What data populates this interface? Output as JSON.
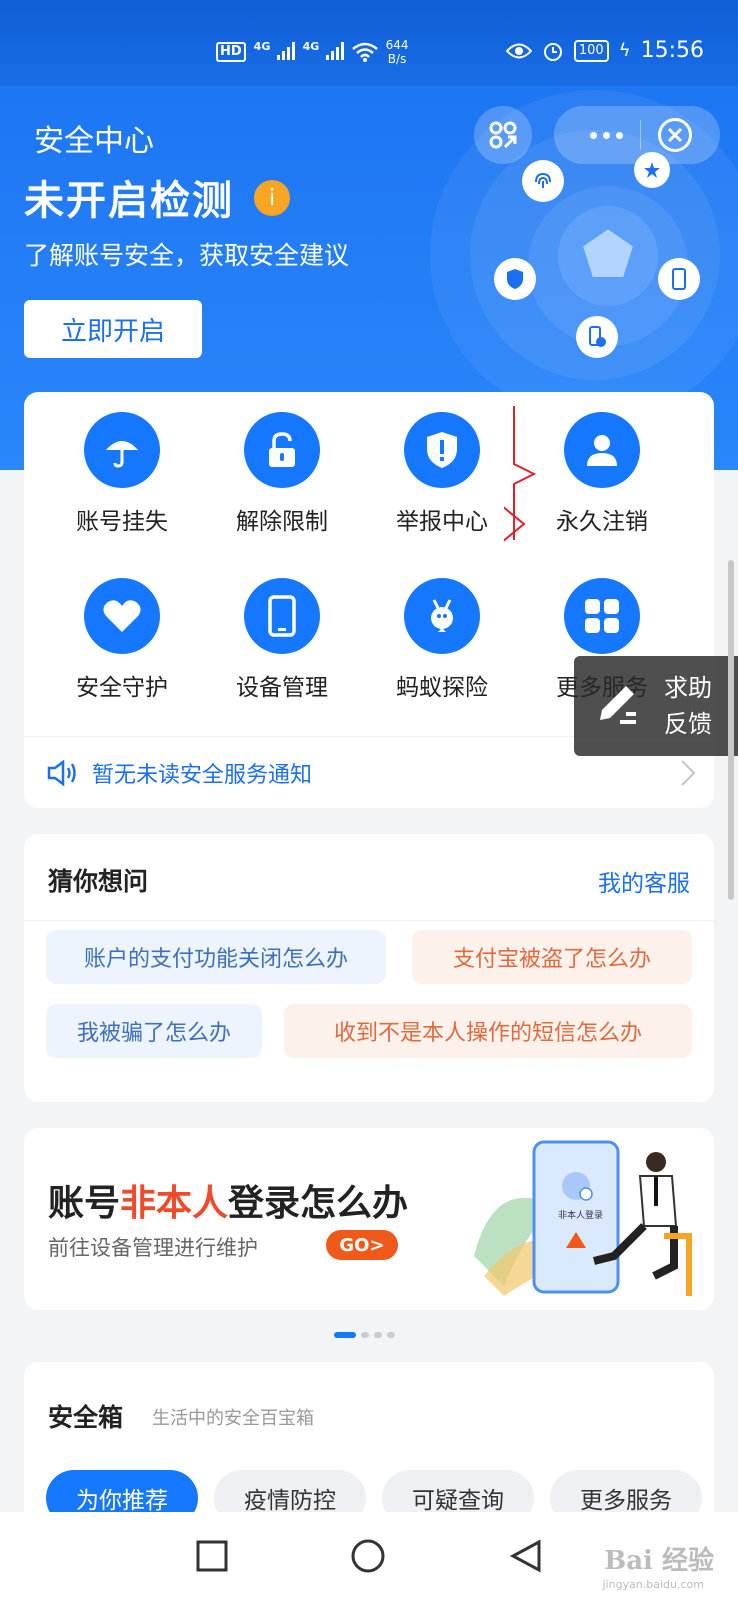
{
  "status_bar": {
    "hd": "HD",
    "net1": "4G",
    "net2": "4G",
    "speed_value": "644",
    "speed_unit": "B/s",
    "battery": "100",
    "time": "15:56"
  },
  "header": {
    "page_title": "安全中心",
    "status_title": "未开启检测",
    "info_badge": "i",
    "subtitle": "了解账号安全，获取安全建议",
    "open_button": "立即开启"
  },
  "service_grid": [
    {
      "label": "账号挂失",
      "icon": "umbrella-icon"
    },
    {
      "label": "解除限制",
      "icon": "unlock-icon"
    },
    {
      "label": "举报中心",
      "icon": "shield-alert-icon"
    },
    {
      "label": "永久注销",
      "icon": "person-icon"
    },
    {
      "label": "安全守护",
      "icon": "heart-icon"
    },
    {
      "label": "设备管理",
      "icon": "phone-icon"
    },
    {
      "label": "蚂蚁探险",
      "icon": "ant-icon"
    },
    {
      "label": "更多服务",
      "icon": "grid-icon"
    }
  ],
  "notice": {
    "text": "暂无未读安全服务通知"
  },
  "float_help": {
    "line1": "求助",
    "line2": "反馈"
  },
  "guess": {
    "title": "猜你想问",
    "link": "我的客服",
    "chips": [
      "账户的支付功能关闭怎么办",
      "支付宝被盗了怎么办",
      "我被骗了怎么办",
      "收到不是本人操作的短信怎么办"
    ]
  },
  "banner": {
    "title_a": "账号",
    "title_highlight": "非本人",
    "title_b": "登录怎么办",
    "subtitle": "前往设备管理进行维护",
    "go": "GO>",
    "illus_text": "非本人登录"
  },
  "carousel": {
    "pages": 4,
    "active": 1
  },
  "safe_box": {
    "title": "安全箱",
    "subtitle": "生活中的安全百宝箱",
    "tabs": [
      "为你推荐",
      "疫情防控",
      "可疑查询",
      "更多服务"
    ]
  },
  "watermark": {
    "brand": "Bai 经验",
    "site": "jingyan.baidu.com"
  },
  "colors": {
    "primary": "#1677ff",
    "header_blue": "#1b73f0",
    "accent_orange": "#ef5a1a",
    "highlight_red": "#ef4b2a",
    "info_orange": "#f6a623"
  }
}
